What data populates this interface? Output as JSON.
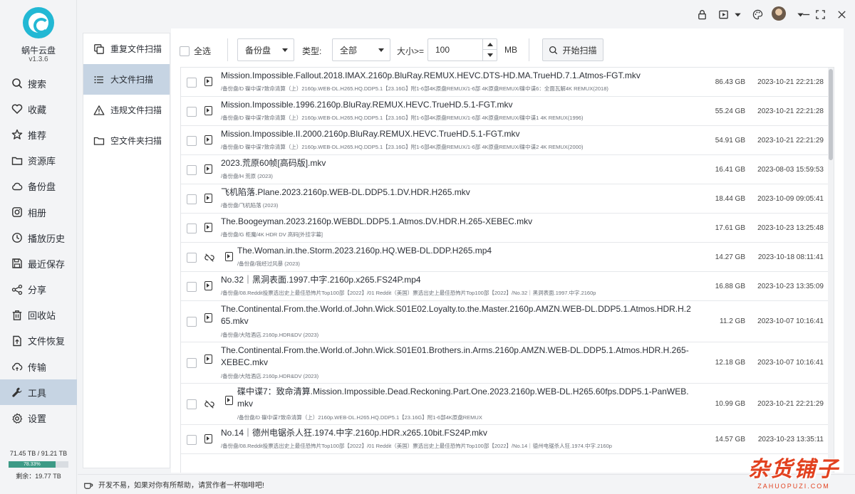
{
  "app": {
    "name": "蜗牛云盘",
    "version": "v1.3.6"
  },
  "nav": {
    "items": [
      {
        "label": "搜索",
        "icon": "search-icon"
      },
      {
        "label": "收藏",
        "icon": "heart-icon"
      },
      {
        "label": "推荐",
        "icon": "star-icon"
      },
      {
        "label": "资源库",
        "icon": "folder-icon"
      },
      {
        "label": "备份盘",
        "icon": "cloud-icon"
      },
      {
        "label": "相册",
        "icon": "photo-icon"
      },
      {
        "label": "播放历史",
        "icon": "history-icon"
      },
      {
        "label": "最近保存",
        "icon": "save-icon"
      },
      {
        "label": "分享",
        "icon": "share-icon"
      },
      {
        "label": "回收站",
        "icon": "trash-icon"
      },
      {
        "label": "文件恢复",
        "icon": "file-restore-icon"
      },
      {
        "label": "传输",
        "icon": "transfer-icon"
      },
      {
        "label": "工具",
        "icon": "wrench-icon",
        "active": true
      },
      {
        "label": "设置",
        "icon": "gear-icon"
      }
    ]
  },
  "storage": {
    "used_total": "71.45 TB / 91.21 TB",
    "percent_label": "78.33%",
    "percent": 78.33,
    "free": "剩余：19.77 TB"
  },
  "tools": {
    "items": [
      {
        "label": "重复文件扫描",
        "icon": "duplicate-icon"
      },
      {
        "label": "大文件扫描",
        "icon": "list-icon",
        "active": true
      },
      {
        "label": "违规文件扫描",
        "icon": "warning-icon"
      },
      {
        "label": "空文件夹扫描",
        "icon": "empty-folder-icon"
      }
    ]
  },
  "filter": {
    "select_all": "全选",
    "source": "备份盘",
    "type_label": "类型:",
    "type_value": "全部",
    "size_label": "大小>=",
    "size_value": "100",
    "size_unit": "MB",
    "scan_button": "开始扫描"
  },
  "files": [
    {
      "name": "Mission.Impossible.Fallout.2018.IMAX.2160p.BluRay.REMUX.HEVC.DTS-HD.MA.TrueHD.7.1.Atmos-FGT.mkv",
      "path": "/备份盘/D 碟中谍7致命清算（上）2160p.WEB-DL.H265.HQ.DDP5.1【23.16G】附1-6部4K原盘REMUX/1-6部 4K原盘REMUX/碟中谍6：全面瓦解4K REMUX(2018)",
      "size": "86.43 GB",
      "time": "2023-10-21 22:21:28",
      "unlinked": false
    },
    {
      "name": "Mission.Impossible.1996.2160p.BluRay.REMUX.HEVC.TrueHD.5.1-FGT.mkv",
      "path": "/备份盘/D 碟中谍7致命清算（上）2160p.WEB-DL.H265.HQ.DDP5.1【23.16G】附1-6部4K原盘REMUX/1-6部 4K原盘REMUX/碟中谍1 4K REMUX(1996)",
      "size": "55.24 GB",
      "time": "2023-10-21 22:21:28",
      "unlinked": false
    },
    {
      "name": "Mission.Impossible.II.2000.2160p.BluRay.REMUX.HEVC.TrueHD.5.1-FGT.mkv",
      "path": "/备份盘/D 碟中谍7致命清算（上）2160p.WEB-DL.H265.HQ.DDP5.1【23.16G】附1-6部4K原盘REMUX/1-6部 4K原盘REMUX/碟中谍2 4K REMUX(2000)",
      "size": "54.91 GB",
      "time": "2023-10-21 22:21:29",
      "unlinked": false
    },
    {
      "name": "2023.荒原60帧[高码版].mkv",
      "path": "/备份盘/H 荒原 (2023)",
      "size": "16.41 GB",
      "time": "2023-08-03 15:59:53",
      "unlinked": false
    },
    {
      "name": "飞机陷落.Plane.2023.2160p.WEB-DL.DDP5.1.DV.HDR.H265.mkv",
      "path": "/备份盘/飞机陷落 (2023)",
      "size": "18.44 GB",
      "time": "2023-10-09 09:05:41",
      "unlinked": false
    },
    {
      "name": "The.Boogeyman.2023.2160p.WEBDL.DDP5.1.Atmos.DV.HDR.H.265-XEBEC.mkv",
      "path": "/备份盘/G 柜魔/4K HDR DV 高码[外挂字幕]",
      "size": "17.61 GB",
      "time": "2023-10-23 13:25:48",
      "unlinked": false
    },
    {
      "name": "The.Woman.in.the.Storm.2023.2160p.HQ.WEB-DL.DDP.H265.mp4",
      "path": "/备份盘/我经过风暴 (2023)",
      "size": "14.27 GB",
      "time": "2023-10-18 08:11:41",
      "unlinked": true
    },
    {
      "name": "No.32｜黑洞表面.1997.中字.2160p.x265.FS24P.mp4",
      "path": "/备份盘/08.Reddit投票选出史上最佳恐怖片Top100部【2022】/01 Reddit（美国）票选出史上最佳恐怖片Top100部【2022】/No.32｜黑洞表面.1997.中字.2160p",
      "size": "16.88 GB",
      "time": "2023-10-23 13:35:09",
      "unlinked": false
    },
    {
      "name": "The.Continental.From.the.World.of.John.Wick.S01E02.Loyalty.to.the.Master.2160p.AMZN.WEB-DL.DDP5.1.Atmos.HDR.H.265.mkv",
      "path": "/备份盘/大陆酒店.2160p.HDR&DV (2023)",
      "size": "11.2 GB",
      "time": "2023-10-07 10:16:41",
      "unlinked": false
    },
    {
      "name": "The.Continental.From.the.World.of.John.Wick.S01E01.Brothers.in.Arms.2160p.AMZN.WEB-DL.DDP5.1.Atmos.HDR.H.265-XEBEC.mkv",
      "path": "/备份盘/大陆酒店.2160p.HDR&DV (2023)",
      "size": "12.18 GB",
      "time": "2023-10-07 10:16:41",
      "unlinked": false
    },
    {
      "name": "碟中谍7：致命清算.Mission.Impossible.Dead.Reckoning.Part.One.2023.2160p.WEB-DL.H265.60fps.DDP5.1-PanWEB.mkv",
      "path": "/备份盘/D 碟中谍7致命清算（上）2160p.WEB-DL.H265.HQ.DDP5.1【23.16G】附1-6部4K原盘REMUX",
      "size": "10.99 GB",
      "time": "2023-10-21 22:21:29",
      "unlinked": true
    },
    {
      "name": "No.14｜德州电锯杀人狂.1974.中字.2160p.HDR.x265.10bit.FS24P.mkv",
      "path": "/备份盘/08.Reddit投票选出史上最佳恐怖片Top100部【2022】/01 Reddit（美国）票选出史上最佳恐怖片Top100部【2022】/No.14｜德州电锯杀人狂.1974.中字.2160p",
      "size": "14.57 GB",
      "time": "2023-10-23 13:35:11",
      "unlinked": false
    }
  ],
  "statusbar": {
    "message": "开发不易，如果对你有所帮助，请赏作者一杯咖啡吧!"
  },
  "watermark": {
    "main": "杂货铺子",
    "sub": "ZAHUOPUZI.COM"
  },
  "colors": {
    "accent": "#22b8d4",
    "active_bg": "#c6d4e3",
    "storage_fill": "#3d9a86",
    "watermark": "#e2411f"
  }
}
